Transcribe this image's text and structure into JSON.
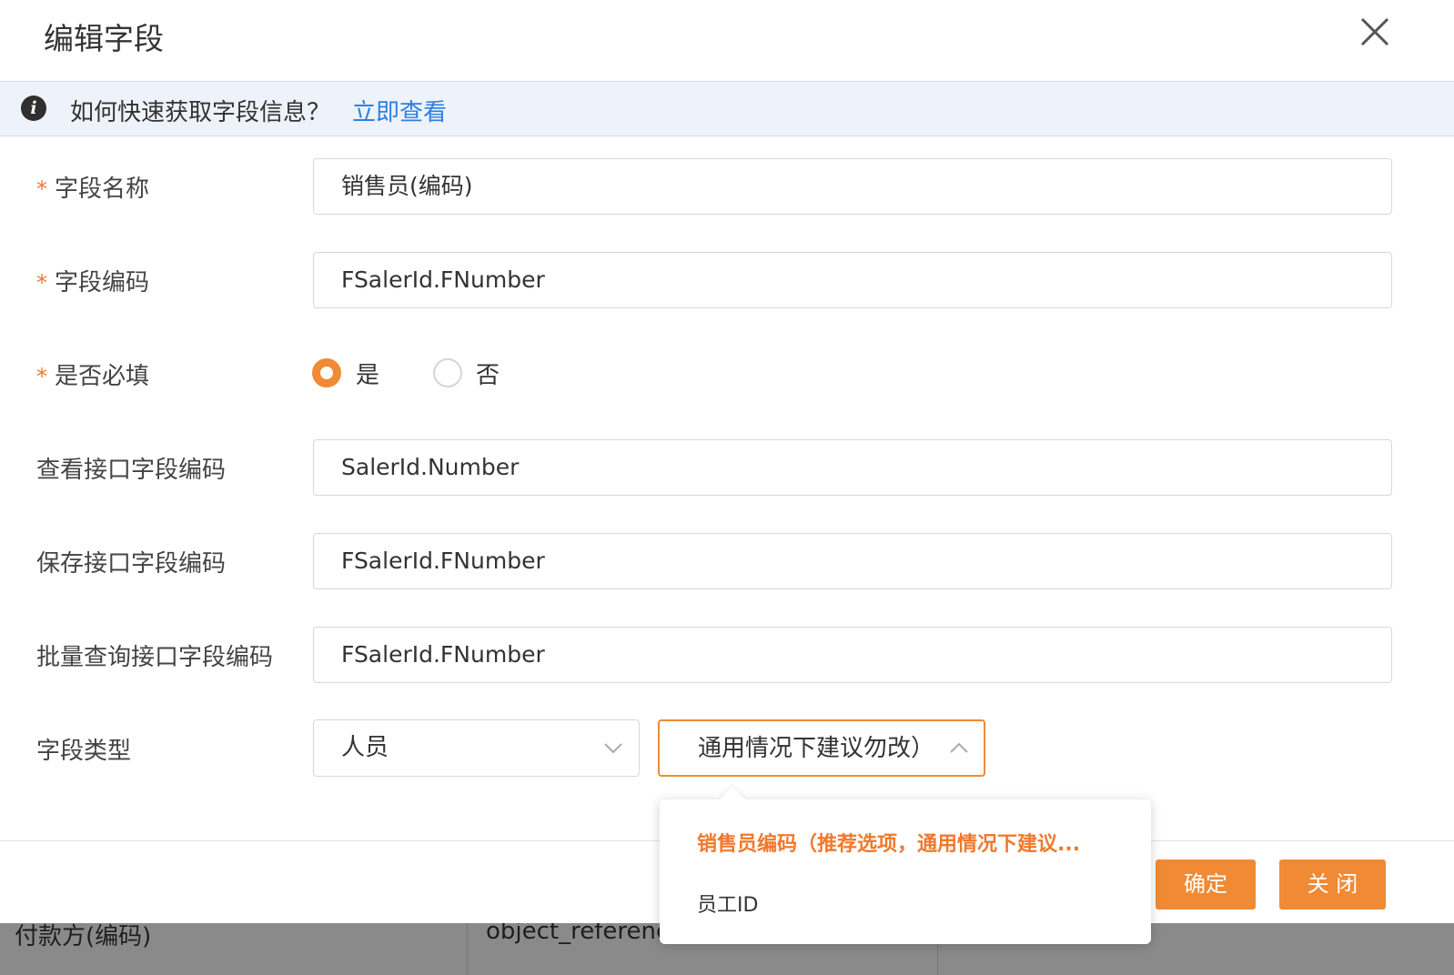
{
  "background": {
    "cell1": "付款方(编码)",
    "cell2": "object_referenc"
  },
  "modal": {
    "title": "编辑字段",
    "info": {
      "question": "如何快速获取字段信息？",
      "link": "立即查看"
    },
    "fields": {
      "name": {
        "label": "字段名称",
        "value": "销售员(编码)"
      },
      "code": {
        "label": "字段编码",
        "value": "FSalerId.FNumber"
      },
      "required": {
        "label": "是否必填",
        "yes": "是",
        "no": "否",
        "selected": "是"
      },
      "view_code": {
        "label": "查看接口字段编码",
        "value": "SalerId.Number"
      },
      "save_code": {
        "label": "保存接口字段编码",
        "value": "FSalerId.FNumber"
      },
      "batch_code": {
        "label": "批量查询接口字段编码",
        "value": "FSalerId.FNumber"
      },
      "type": {
        "label": "字段类型",
        "primary_value": "人员",
        "secondary_value": "通用情况下建议勿改）"
      }
    },
    "required_mark": "*",
    "dropdown": {
      "options": [
        "销售员编码（推荐选项，通用情况下建议...",
        "员工ID"
      ]
    },
    "buttons": {
      "confirm": "确定",
      "close": "关 闭"
    }
  },
  "colors": {
    "accent": "#f08a34",
    "link": "#2f7fe0",
    "info_bg": "#eef2fa"
  }
}
